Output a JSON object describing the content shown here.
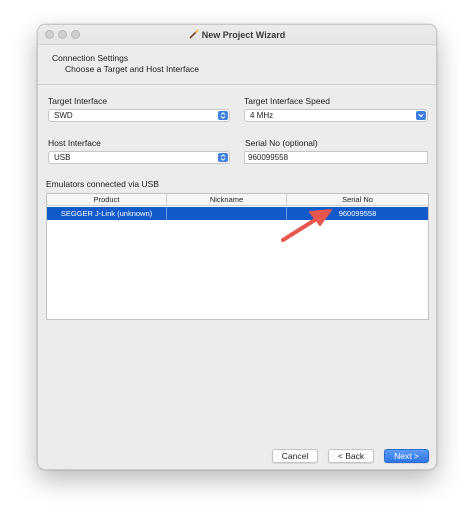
{
  "window": {
    "title": "New Project Wizard"
  },
  "header": {
    "title": "Connection Settings",
    "subtitle": "Choose a Target and Host Interface"
  },
  "form": {
    "target_interface": {
      "label": "Target Interface",
      "value": "SWD"
    },
    "target_speed": {
      "label": "Target Interface Speed",
      "value": "4 MHz"
    },
    "host_interface": {
      "label": "Host Interface",
      "value": "USB"
    },
    "serial_no": {
      "label": "Serial No (optional)",
      "value": "960099558"
    }
  },
  "emulators": {
    "label": "Emulators connected via USB",
    "columns": [
      "Product",
      "Nickname",
      "Serial No"
    ],
    "rows": [
      {
        "product": "SEGGER J-Link (unknown)",
        "nickname": "",
        "serial": "960099558",
        "selected": true
      }
    ]
  },
  "buttons": {
    "cancel": "Cancel",
    "back": "< Back",
    "next": "Next >"
  },
  "colors": {
    "accent": "#2f76e6",
    "selection": "#1259c9",
    "annotation_arrow": "#e8574f"
  }
}
